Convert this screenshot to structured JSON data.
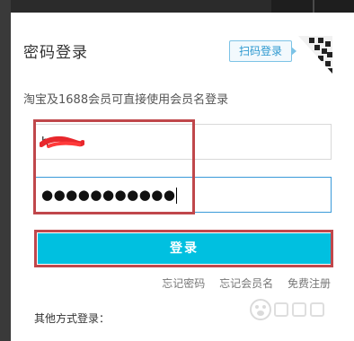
{
  "login": {
    "title": "密码登录",
    "qr_tab_label": "扫码登录",
    "hint": "淘宝及1688会员可直接使用会员名登录",
    "username_value": "h",
    "password_mask": "●●●●●●●●●●●",
    "submit_label": "登录",
    "links": {
      "forgot_password": "忘记密码",
      "forgot_username": "忘记会员名",
      "register": "免费注册"
    },
    "other_methods_label": "其他方式登录："
  },
  "colors": {
    "accent": "#00c0e0",
    "highlight": "#c0474b",
    "qr_tab": "#2c98cf"
  },
  "icons": {
    "qr": "qr-corner-icon",
    "watermark": "baidu-watermark-logo"
  }
}
